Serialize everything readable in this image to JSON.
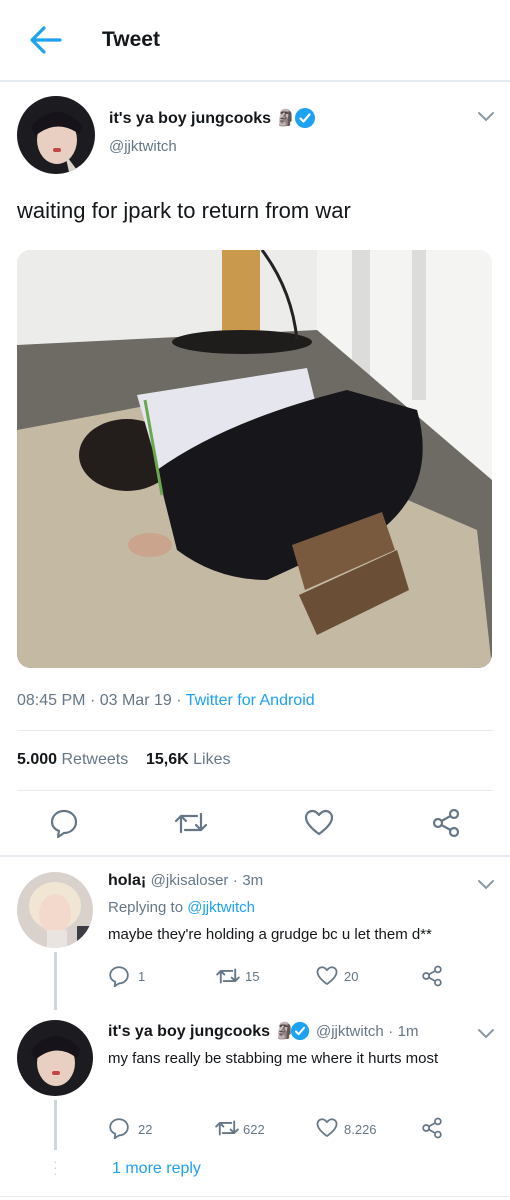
{
  "header": {
    "title": "Tweet",
    "back_icon": "arrow-left-icon"
  },
  "tweet": {
    "author_name": "it's ya boy jungcooks",
    "emoji": "🗿",
    "handle": "@jjktwitch",
    "text": "waiting for jpark to return from war",
    "time": "08:45 PM",
    "date": "03 Mar 19",
    "source": "Twitter for Android",
    "retweets_count": "5.000",
    "retweets_label": "Retweets",
    "likes_count": "15,6K",
    "likes_label": "Likes"
  },
  "replies": [
    {
      "name": "hola¡",
      "handle": "@jkisaloser",
      "time": "3m",
      "replying_prefix": "Replying to",
      "replying_to": "@jjktwitch",
      "text": "maybe they're holding a grudge bc u let them d**",
      "reply_count": "1",
      "retweet_count": "15",
      "like_count": "20"
    },
    {
      "name": "it's ya boy jungcooks",
      "emoji": "🗿",
      "handle": "@jjktwitch",
      "time": "1m",
      "text": "my fans really be stabbing me where it hurts most",
      "reply_count": "22",
      "retweet_count": "622",
      "like_count": "8.226"
    }
  ],
  "more_reply": "1 more reply",
  "colors": {
    "accent": "#1da1f2",
    "muted": "#657786",
    "border": "#e6ecf0"
  }
}
